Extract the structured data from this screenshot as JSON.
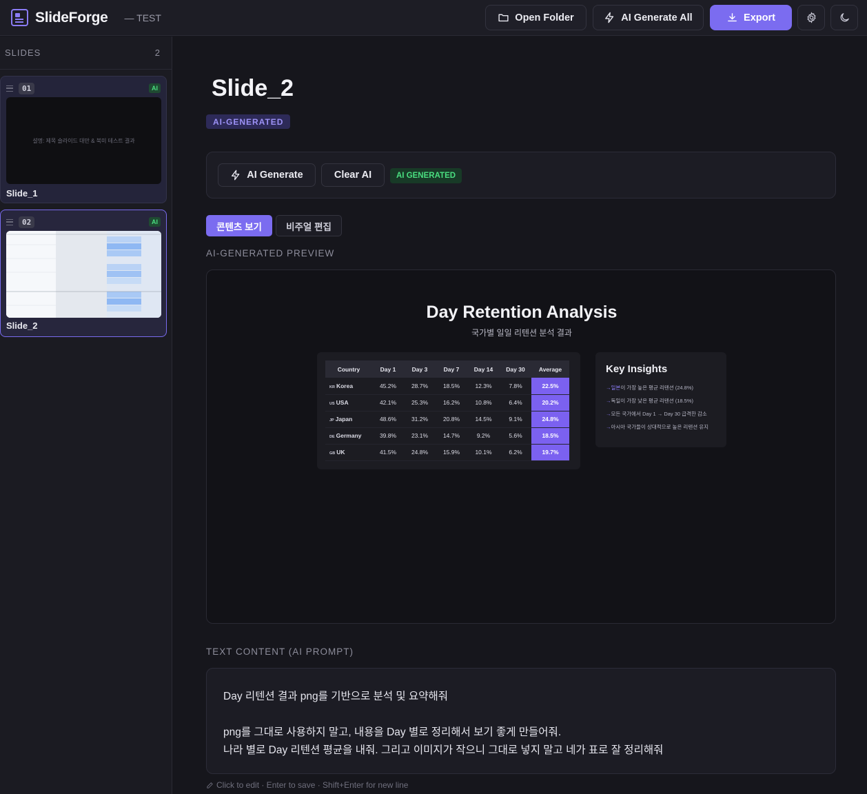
{
  "header": {
    "app_name": "SlideForge",
    "project_label": "— TEST",
    "open_folder_label": "Open Folder",
    "ai_generate_all_label": "AI Generate All",
    "export_label": "Export",
    "icons": {
      "logo": "slides-logo-icon",
      "folder": "folder-icon",
      "bolt": "bolt-icon",
      "download": "download-icon",
      "settings": "gear-icon",
      "theme": "moon-icon"
    }
  },
  "sidebar": {
    "title": "SLIDES",
    "count": "2",
    "slides": [
      {
        "number": "01",
        "badge": "AI",
        "name": "Slide_1",
        "thumb_text": "설명: 제목 슬라이드 대만 & 북미 테스트 결과"
      },
      {
        "number": "02",
        "badge": "AI",
        "name": "Slide_2"
      }
    ]
  },
  "main": {
    "title": "Slide_2",
    "badge": "AI-GENERATED",
    "ai_generate_label": "AI Generate",
    "clear_ai_label": "Clear AI",
    "generated_pill": "AI GENERATED",
    "tabs": [
      "콘텐츠 보기",
      "비주얼 편집"
    ],
    "preview_label": "AI-GENERATED PREVIEW",
    "text_content_label": "TEXT CONTENT (AI PROMPT)",
    "prompt_lines": [
      "Day 리텐션 결과 png를 기반으로 분석 및 요약해줘",
      "png를 그대로 사용하지 말고, 내용을 Day 별로 정리해서 보기 좋게 만들어줘.",
      "나라 별로 Day 리텐션 평균을 내줘. 그리고 이미지가 작으니 그대로 넣지 말고 네가 표로 잘 정리해줘"
    ],
    "hint": "Click to edit · Enter to save · Shift+Enter for new line"
  },
  "preview": {
    "title": "Day Retention Analysis",
    "subtitle": "국가별 일일 리텐션 분석 결과",
    "table": {
      "headers": [
        "Country",
        "Day 1",
        "Day 3",
        "Day 7",
        "Day 14",
        "Day 30",
        "Average"
      ],
      "rows": [
        {
          "flag": "KR",
          "country": "Korea",
          "values": [
            "45.2%",
            "28.7%",
            "18.5%",
            "12.3%",
            "7.8%"
          ],
          "avg": "22.5%"
        },
        {
          "flag": "US",
          "country": "USA",
          "values": [
            "42.1%",
            "25.3%",
            "16.2%",
            "10.8%",
            "6.4%"
          ],
          "avg": "20.2%"
        },
        {
          "flag": "JP",
          "country": "Japan",
          "values": [
            "48.6%",
            "31.2%",
            "20.8%",
            "14.5%",
            "9.1%"
          ],
          "avg": "24.8%"
        },
        {
          "flag": "DE",
          "country": "Germany",
          "values": [
            "39.8%",
            "23.1%",
            "14.7%",
            "9.2%",
            "5.6%"
          ],
          "avg": "18.5%"
        },
        {
          "flag": "GB",
          "country": "UK",
          "values": [
            "41.5%",
            "24.8%",
            "15.9%",
            "10.1%",
            "6.2%"
          ],
          "avg": "19.7%"
        }
      ]
    },
    "insights": {
      "title": "Key Insights",
      "items": [
        {
          "arrow": "→",
          "highlight": "일본",
          "text": "이 가장 높은 평균 리텐션 (24.8%)"
        },
        {
          "arrow": "→",
          "highlight": "",
          "text": "독일이 가장 낮은 평균 리텐션 (18.5%)"
        },
        {
          "arrow": "→",
          "highlight": "",
          "text": "모든 국가에서 Day 1 → Day 30 급격한 감소"
        },
        {
          "arrow": "→",
          "highlight": "",
          "text": "아시아 국가들이 상대적으로 높은 리텐션 유지"
        }
      ]
    }
  },
  "colors": {
    "accent": "#7b6cf0",
    "success": "#4ade80",
    "background": "#16161c"
  }
}
